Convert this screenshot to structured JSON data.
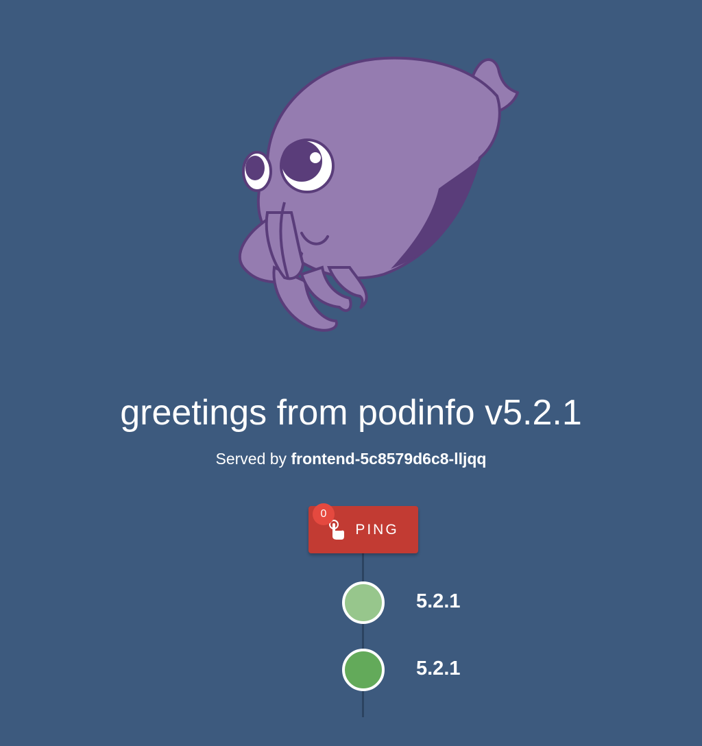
{
  "header": {
    "title": "greetings from podinfo v5.2.1",
    "served_prefix": "Served by",
    "served_host": "frontend-5c8579d6c8-lljqq"
  },
  "mascot": {
    "icon": "cuttlefish-mascot-icon"
  },
  "ping": {
    "label": "PING",
    "count": "0",
    "icon": "touch-app-icon"
  },
  "timeline": {
    "items": [
      {
        "label": "5.2.1",
        "color": "#97c68c"
      },
      {
        "label": "5.2.1",
        "color": "#63aa5a"
      }
    ]
  },
  "colors": {
    "background": "#3d5a7e",
    "button": "#c23b33",
    "badge": "#e5493f",
    "mascot_body": "#957cb0",
    "mascot_dark": "#5a3d7a"
  }
}
